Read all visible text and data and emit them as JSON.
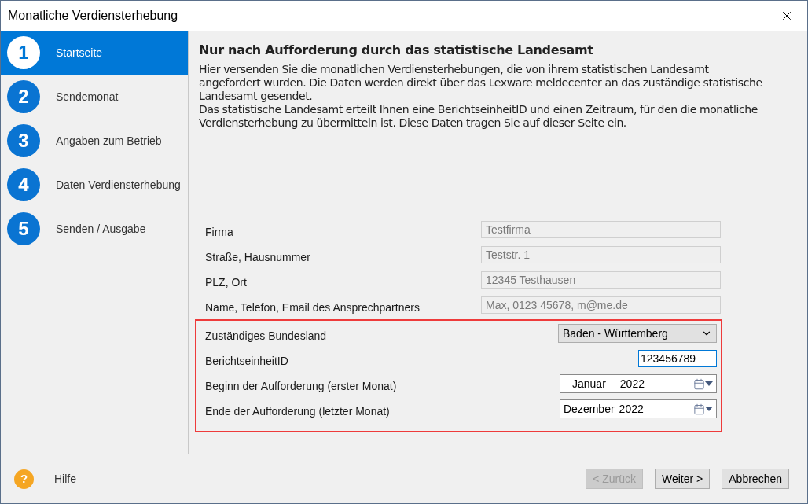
{
  "window": {
    "title": "Monatliche Verdiensterhebung"
  },
  "steps": [
    {
      "number": "1",
      "label": "Startseite",
      "selected": true
    },
    {
      "number": "2",
      "label": "Sendemonat",
      "selected": false
    },
    {
      "number": "3",
      "label": "Angaben zum Betrieb",
      "selected": false
    },
    {
      "number": "4",
      "label": "Daten Verdiensterhebung",
      "selected": false
    },
    {
      "number": "5",
      "label": "Senden / Ausgabe",
      "selected": false
    }
  ],
  "heading": "Nur nach Aufforderung durch das statistische Landesamt",
  "paragraphs": [
    "Hier  versenden Sie die monatlichen Verdiensterhebungen, die von ihrem statistischen Landesamt angefordert wurden. Die Daten werden direkt über das Lexware meldecenter an das zuständige statistische Landesamt gesendet.",
    "Das statistische Landesamt erteilt Ihnen eine BerichtseinheitID und einen Zeitraum, für den die monatliche Verdiensterhebung zu übermitteln ist. Diese Daten tragen Sie auf dieser Seite ein."
  ],
  "company_fields": [
    {
      "kind": "readonly",
      "label": "Firma",
      "value": "Testfirma"
    },
    {
      "kind": "readonly",
      "label": "Straße, Hausnummer",
      "value": "Teststr. 1"
    },
    {
      "kind": "readonly",
      "label": "PLZ, Ort",
      "value": "12345 Testhausen"
    },
    {
      "kind": "readonly",
      "label": "Name, Telefon, Email des Ansprechpartners",
      "value": "Max, 0123 45678, m@me.de"
    }
  ],
  "highlighted_fields": [
    {
      "kind": "select",
      "label": "Zuständiges Bundesland",
      "value": "Baden - Württemberg"
    },
    {
      "kind": "input",
      "label": "BerichtseinheitID",
      "value": "123456789"
    },
    {
      "kind": "month",
      "label": "Beginn der Aufforderung (erster Monat)",
      "month": "Januar",
      "year": "2022"
    },
    {
      "kind": "month",
      "label": "Ende der Aufforderung (letzter Monat)",
      "month": "Dezember",
      "year": "2022"
    }
  ],
  "footer": {
    "help_icon": "?",
    "help_label": "Hilfe",
    "buttons": [
      {
        "label": "< Zurück",
        "disabled": true
      },
      {
        "label": "Weiter >",
        "disabled": false
      },
      {
        "label": "Abbrechen",
        "disabled": false
      }
    ]
  }
}
